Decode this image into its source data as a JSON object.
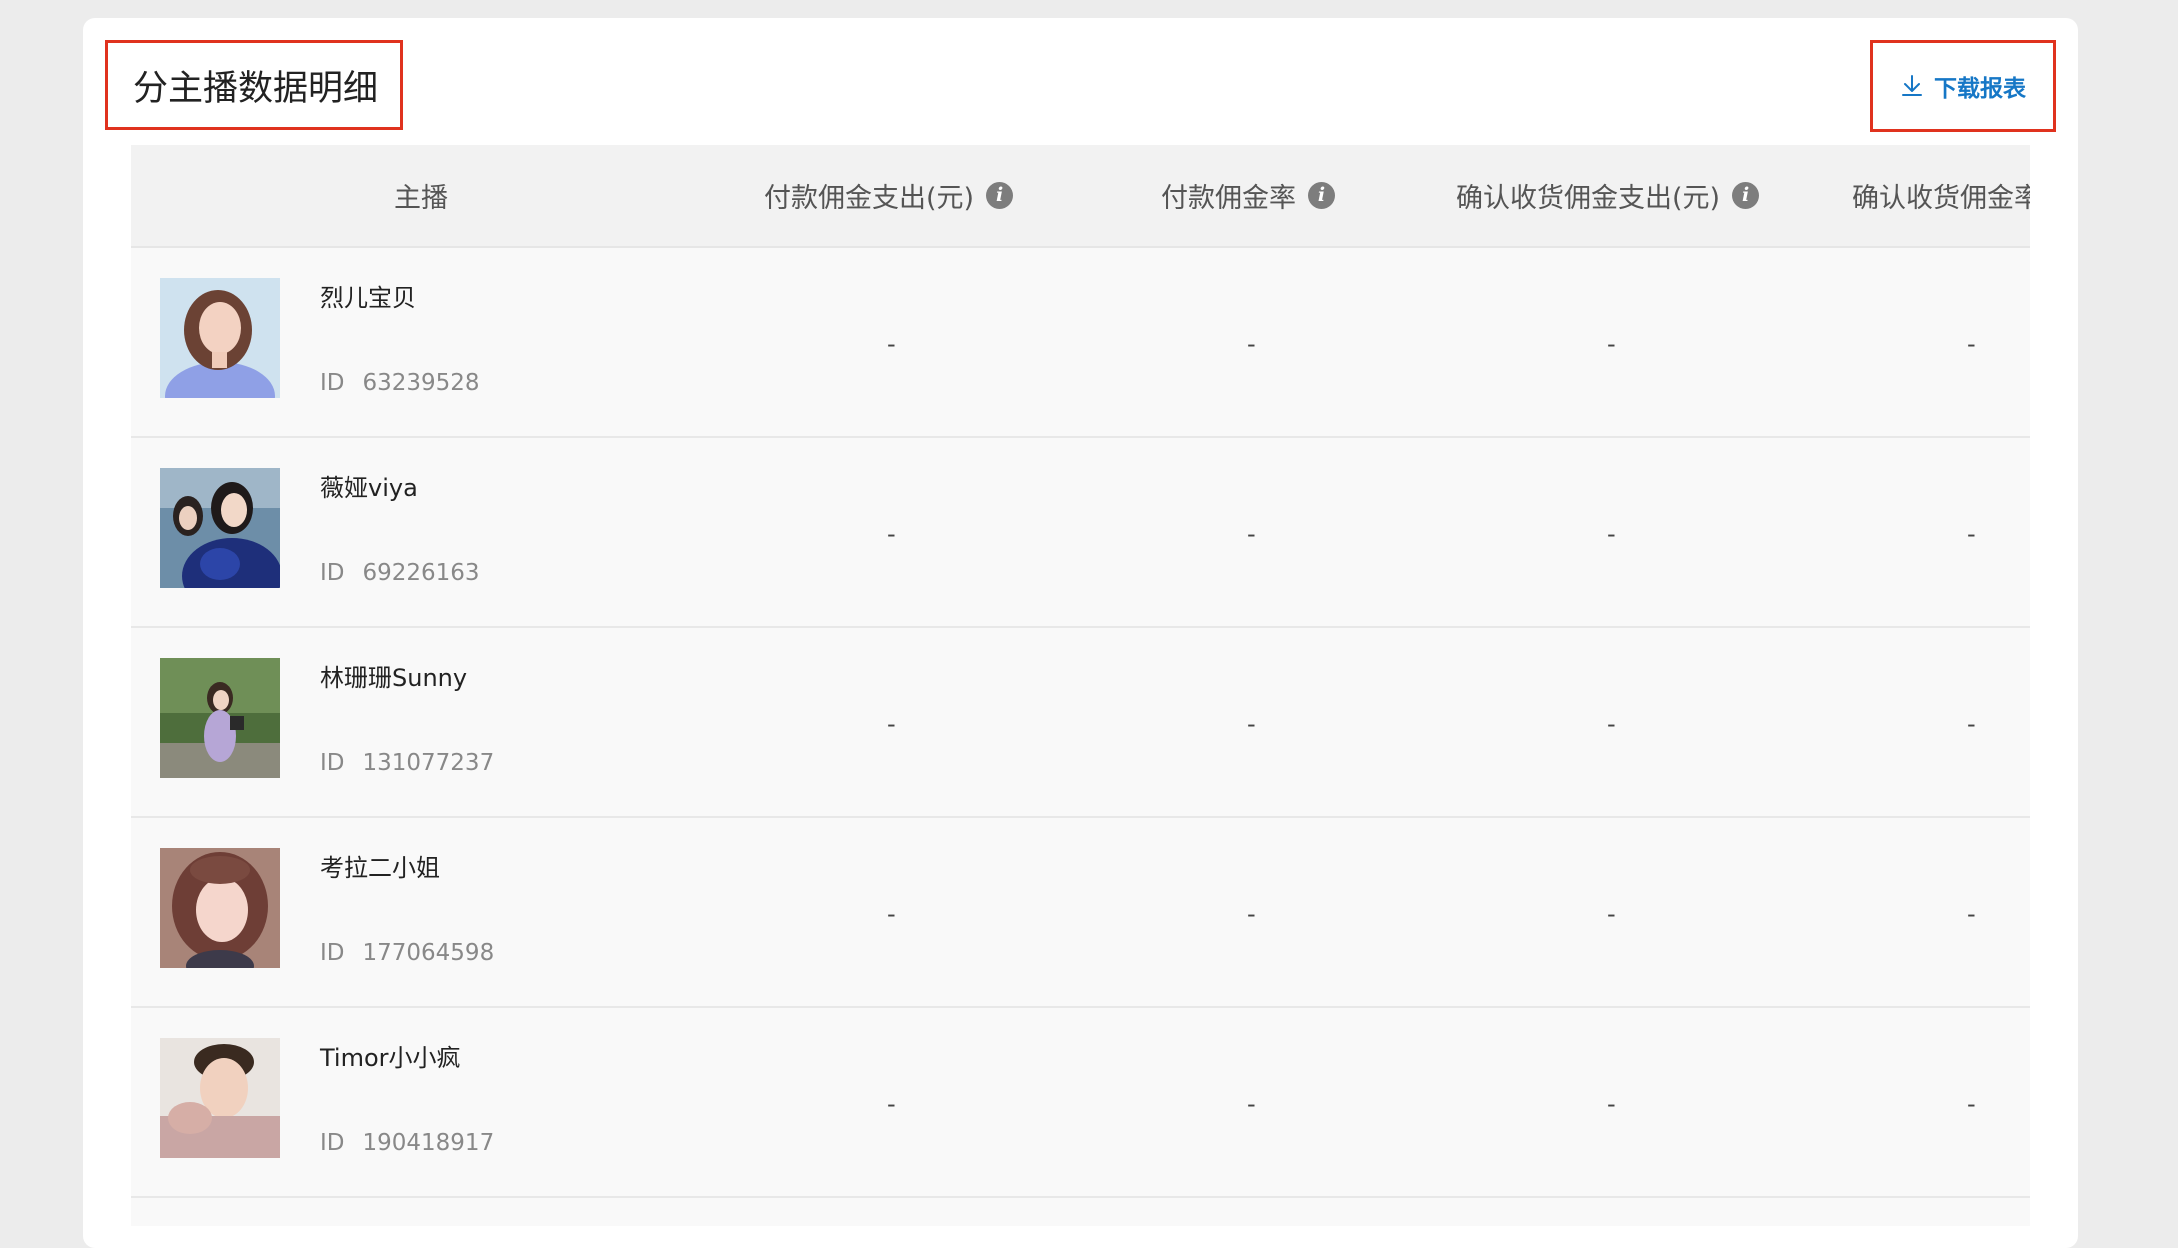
{
  "header": {
    "title": "分主播数据明细",
    "download_label": "下载报表"
  },
  "table": {
    "columns": [
      {
        "label": "主播",
        "info": false
      },
      {
        "label": "付款佣金支出(元)",
        "info": true
      },
      {
        "label": "付款佣金率",
        "info": true
      },
      {
        "label": "确认收货佣金支出(元)",
        "info": true
      },
      {
        "label": "确认收货佣金率",
        "info": false
      }
    ],
    "id_label": "ID",
    "rows": [
      {
        "name": "烈儿宝贝",
        "id": "63239528",
        "values": [
          "-",
          "-",
          "-",
          "-"
        ]
      },
      {
        "name": "薇娅viya",
        "id": "69226163",
        "values": [
          "-",
          "-",
          "-",
          "-"
        ]
      },
      {
        "name": "林珊珊Sunny",
        "id": "131077237",
        "values": [
          "-",
          "-",
          "-",
          "-"
        ]
      },
      {
        "name": "考拉二小姐",
        "id": "177064598",
        "values": [
          "-",
          "-",
          "-",
          "-"
        ]
      },
      {
        "name": "Timor小小疯",
        "id": "190418917",
        "values": [
          "-",
          "-",
          "-",
          "-"
        ]
      }
    ]
  },
  "icons": {
    "download": "download-icon",
    "info": "info-icon"
  },
  "colors": {
    "accent": "#1677c6",
    "highlight_border": "#e0321e"
  }
}
